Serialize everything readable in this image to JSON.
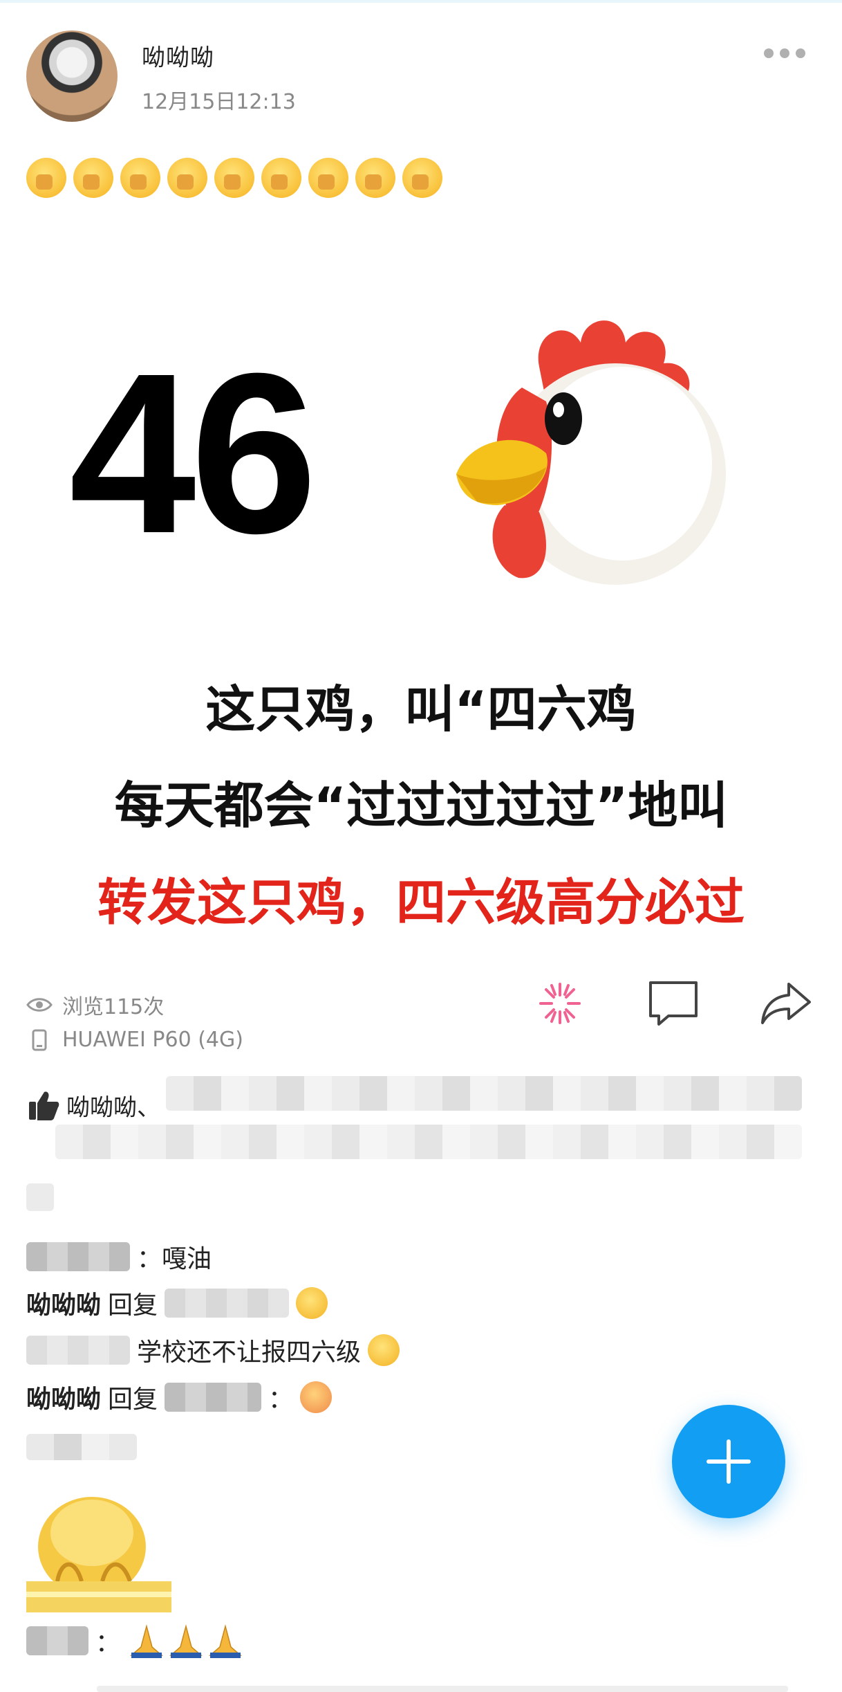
{
  "post": {
    "author": "呦呦呦",
    "time": "12月15日12:13",
    "emoji_count": 9,
    "image": {
      "big_number": "46",
      "line1": "这只鸡，叫“四六鸡",
      "line2": "每天都会“过过过过过”地叫",
      "line3": "转发这只鸡，四六级高分必过",
      "line3_color": "#e3241b"
    },
    "views": "浏览115次",
    "device": "HUAWEI P60 (4G)"
  },
  "likes": {
    "first_liker": "呦呦呦、"
  },
  "comments": [
    {
      "text": "：嘎油"
    },
    {
      "name": "呦呦呦",
      "action": "回复"
    },
    {
      "text": "学校还不让报四六级"
    },
    {
      "name": "呦呦呦",
      "action": "回复",
      "tail": "："
    },
    {
      "tail": "："
    }
  ],
  "colors": {
    "accent": "#119ef3",
    "text": "#222222",
    "meta": "#888888",
    "icon": "#333333"
  }
}
